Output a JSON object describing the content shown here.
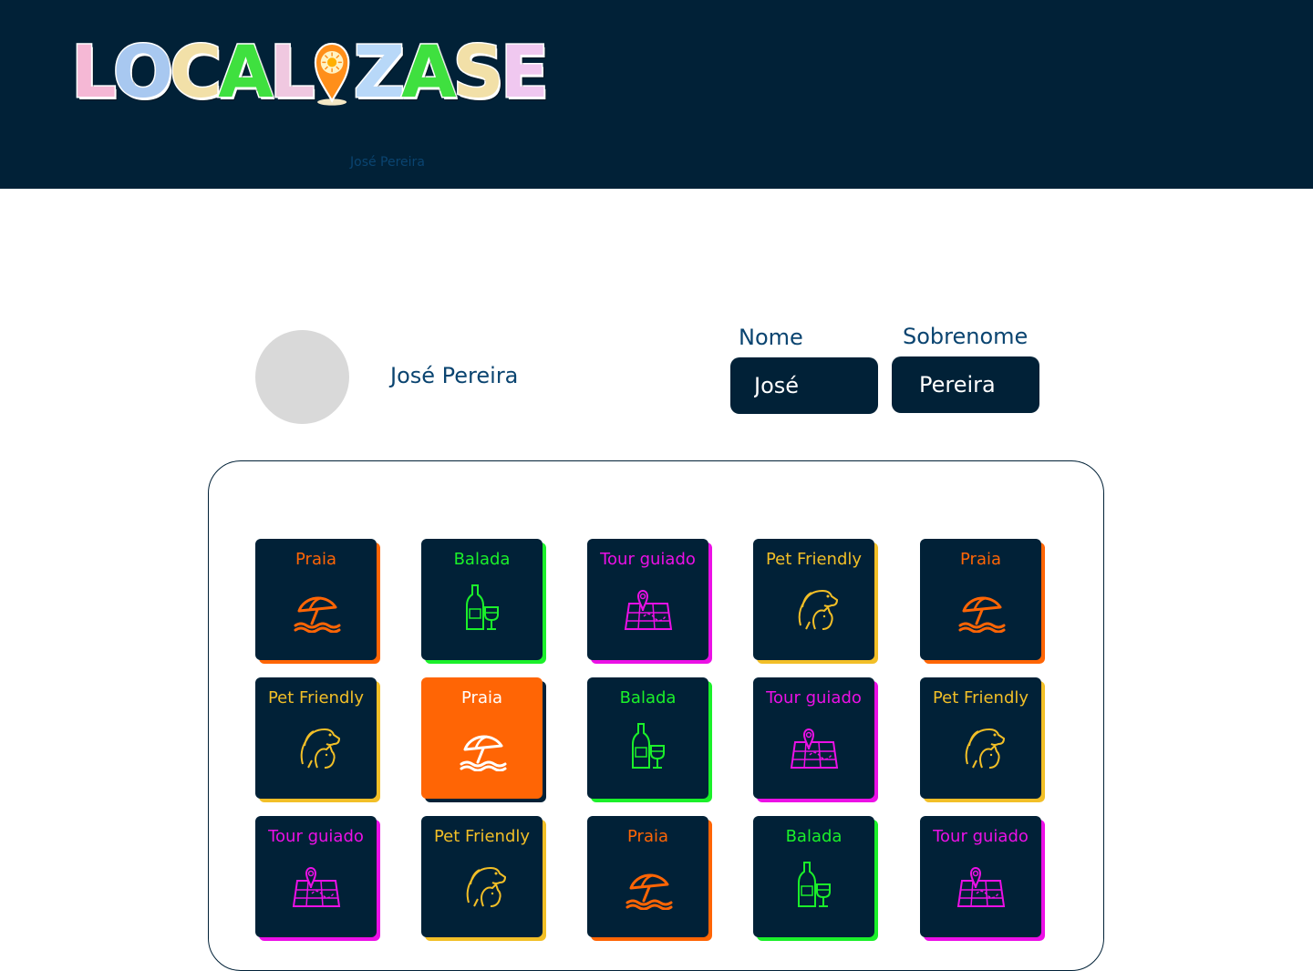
{
  "header": {
    "logo_letters_left": [
      "L",
      "O",
      "C",
      "A",
      "L"
    ],
    "logo_letters_right": [
      "Z",
      "A",
      "S",
      "E"
    ],
    "logo_colors_left": [
      "#f5b8d5",
      "#a8c8f0",
      "#f2e0a8",
      "#3fe03f",
      "#f0c8e0"
    ],
    "logo_colors_right": [
      "#b8d8f8",
      "#3fe03f",
      "#f2e0a8",
      "#f0c8f0"
    ],
    "user_name": "José Pereira"
  },
  "profile": {
    "name": "José Pereira",
    "first_name_label": "Nome",
    "first_name_value": "José",
    "last_name_label": "Sobrenome",
    "last_name_value": "Pereira"
  },
  "colors": {
    "navy": "#012137",
    "praia": "#ff6505",
    "balada": "#1bf02a",
    "tour": "#ec10e6",
    "pet": "#f2bf27"
  },
  "categories": [
    {
      "label": "Praia",
      "icon": "beach-umbrella-icon",
      "color": "#ff6505",
      "selected": false
    },
    {
      "label": "Balada",
      "icon": "wine-bottle-icon",
      "color": "#1bf02a",
      "selected": false
    },
    {
      "label": "Tour guiado",
      "icon": "map-pin-icon",
      "color": "#ec10e6",
      "selected": false
    },
    {
      "label": "Pet Friendly",
      "icon": "pets-icon",
      "color": "#f2bf27",
      "selected": false
    },
    {
      "label": "Praia",
      "icon": "beach-umbrella-icon",
      "color": "#ff6505",
      "selected": false
    },
    {
      "label": "Pet Friendly",
      "icon": "pets-icon",
      "color": "#f2bf27",
      "selected": false
    },
    {
      "label": "Praia",
      "icon": "beach-umbrella-icon",
      "color": "#ff6505",
      "selected": true
    },
    {
      "label": "Balada",
      "icon": "wine-bottle-icon",
      "color": "#1bf02a",
      "selected": false
    },
    {
      "label": "Tour guiado",
      "icon": "map-pin-icon",
      "color": "#ec10e6",
      "selected": false
    },
    {
      "label": "Pet Friendly",
      "icon": "pets-icon",
      "color": "#f2bf27",
      "selected": false
    },
    {
      "label": "Tour guiado",
      "icon": "map-pin-icon",
      "color": "#ec10e6",
      "selected": false
    },
    {
      "label": "Pet Friendly",
      "icon": "pets-icon",
      "color": "#f2bf27",
      "selected": false
    },
    {
      "label": "Praia",
      "icon": "beach-umbrella-icon",
      "color": "#ff6505",
      "selected": false
    },
    {
      "label": "Balada",
      "icon": "wine-bottle-icon",
      "color": "#1bf02a",
      "selected": false
    },
    {
      "label": "Tour guiado",
      "icon": "map-pin-icon",
      "color": "#ec10e6",
      "selected": false
    }
  ]
}
